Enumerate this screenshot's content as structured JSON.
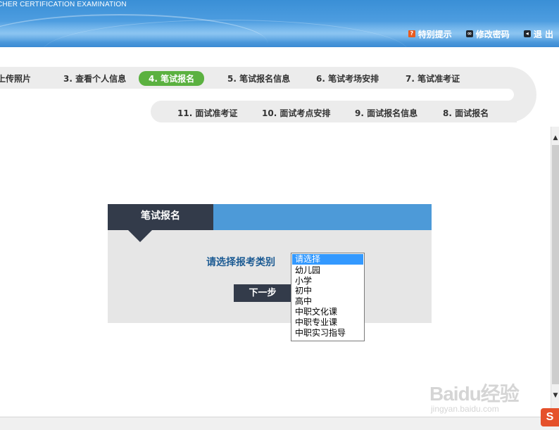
{
  "header": {
    "brand_text": "CHER CERTIFICATION EXAMINATION",
    "links": {
      "special_tips": "特别提示",
      "change_password": "修改密码",
      "logout": "退 出"
    }
  },
  "steps": {
    "s2": "上传照片",
    "s3": "3. 查看个人信息",
    "s4": "4. 笔试报名",
    "s5": "5. 笔试报名信息",
    "s6": "6. 笔试考场安排",
    "s7": "7. 笔试准考证",
    "s8": "8. 面试报名",
    "s9": "9. 面试报名信息",
    "s10": "10. 面试考点安排",
    "s11": "11. 面试准考证"
  },
  "panel": {
    "tab_title": "笔试报名",
    "select_label": "请选择报考类别",
    "next_button": "下一步"
  },
  "dropdown": {
    "options": [
      "请选择",
      "幼儿园",
      "小学",
      "初中",
      "高中",
      "中职文化课",
      "中职专业课",
      "中职实习指导"
    ],
    "selected_index": 0
  },
  "watermark": {
    "logo": "Baidu经验",
    "sub": "jingyan.baidu.com"
  },
  "sogou_badge": "S",
  "colors": {
    "header_blue": "#4d9de0",
    "active_step": "#5bb140",
    "panel_dark": "#333b4a",
    "panel_blue": "#4d9ad8",
    "label_blue": "#1d5b93"
  }
}
